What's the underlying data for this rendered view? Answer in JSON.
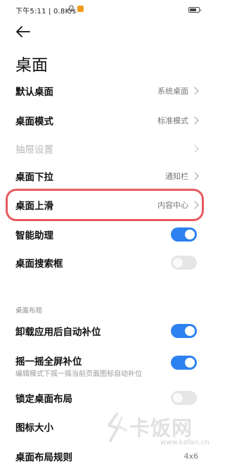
{
  "status_bar": {
    "text": "下午5:11 | 0.8K/s",
    "battery_level": 0.75
  },
  "header": {
    "back_icon": "arrow-left-icon",
    "title": "桌面"
  },
  "settings": {
    "default_desktop": {
      "label": "默认桌面",
      "value": "系统桌面"
    },
    "desktop_mode": {
      "label": "桌面模式",
      "value": "标准模式"
    },
    "drawer_settings": {
      "label": "抽屉设置"
    },
    "desktop_pull_down": {
      "label": "桌面下拉",
      "value": "通知栏"
    },
    "desktop_swipe_up": {
      "label": "桌面上滑",
      "value": "内容中心"
    },
    "smart_assistant": {
      "label": "智能助理",
      "enabled": true
    },
    "desktop_search": {
      "label": "桌面搜索框",
      "enabled": false
    }
  },
  "layout_section": {
    "header": "桌面布局",
    "auto_fill_after_uninstall": {
      "label": "卸载应用后自动补位",
      "enabled": true
    },
    "shake_fill": {
      "label": "摇一摇全屏补位",
      "sub": "编辑模式下摇一摇当前页面图标自动补位",
      "enabled": true
    },
    "lock_layout": {
      "label": "锁定桌面布局",
      "enabled": false
    },
    "icon_size": {
      "label": "图标大小"
    },
    "layout_rules": {
      "label": "桌面布局规则",
      "value": "4x6"
    }
  },
  "watermark": {
    "brand": "卡饭网",
    "url": "www.kafan.cn"
  },
  "colors": {
    "accent": "#2d82f0",
    "highlight": "#e85a5f"
  }
}
